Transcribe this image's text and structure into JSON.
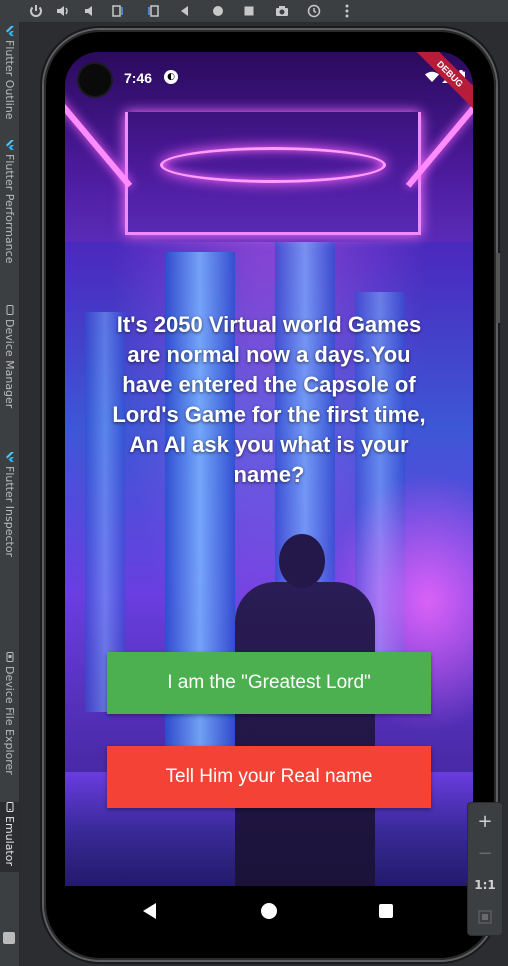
{
  "emulator_toolbar": {
    "buttons": [
      "power-icon",
      "volume-up-icon",
      "volume-down-icon",
      "rotate-left-icon",
      "rotate-right-icon",
      "back-icon",
      "home-icon",
      "overview-icon",
      "camera-icon",
      "snapshot-icon",
      "more-icon"
    ]
  },
  "side_tabs": [
    {
      "label": "Flutter Outline",
      "icon": "flutter-icon"
    },
    {
      "label": "Flutter Performance",
      "icon": "flutter-icon"
    },
    {
      "label": "Device Manager",
      "icon": "device-manager-icon"
    },
    {
      "label": "Flutter Inspector",
      "icon": "flutter-icon"
    },
    {
      "label": "Device File Explorer",
      "icon": "device-file-icon"
    },
    {
      "label": "Emulator",
      "icon": "emulator-icon",
      "active": true
    }
  ],
  "status_bar": {
    "time": "7:46",
    "debug_banner": "DEBUG"
  },
  "story": {
    "text": "It's 2050 Virtual world Games are normal now a days.You have entered the Capsole of Lord's Game for the first time, An AI ask you what is your name?"
  },
  "choices": {
    "choice1": "I am the \"Greatest Lord\"",
    "choice2": "Tell Him your Real name"
  },
  "zoom_controls": {
    "zoom_in": "+",
    "zoom_out": "−",
    "actual_size": "1:1"
  },
  "colors": {
    "choice1_bg": "#4caf50",
    "choice2_bg": "#f44336",
    "debug_banner": "#b71c3a"
  }
}
